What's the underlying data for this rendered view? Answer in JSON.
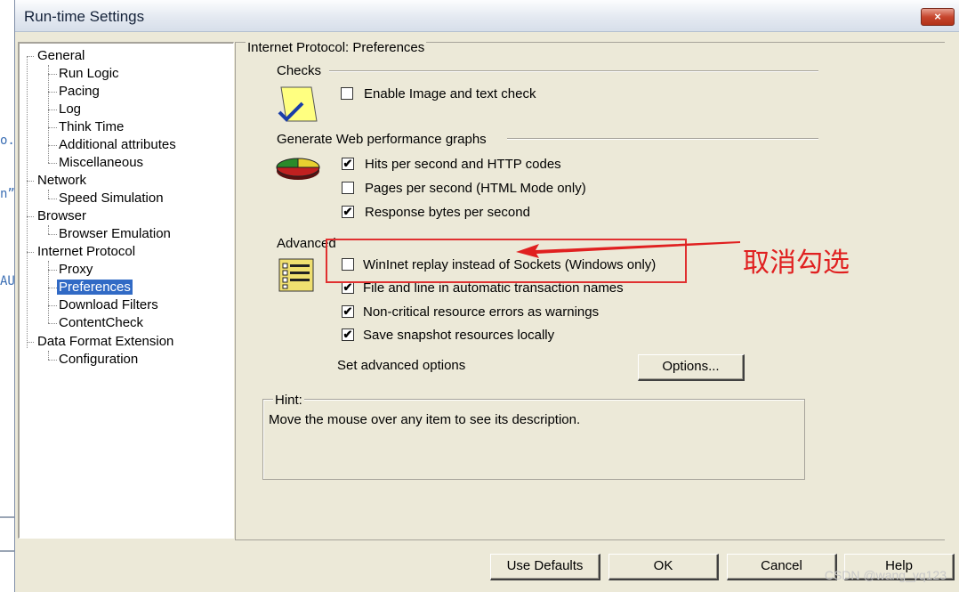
{
  "window": {
    "title": "Run-time Settings",
    "close_label": "×"
  },
  "background": {
    "chars": [
      "o.",
      "n”",
      "AU"
    ]
  },
  "tree": {
    "items": [
      {
        "label": "General",
        "level": 0
      },
      {
        "label": "Run Logic",
        "level": 1
      },
      {
        "label": "Pacing",
        "level": 1
      },
      {
        "label": "Log",
        "level": 1
      },
      {
        "label": "Think Time",
        "level": 1
      },
      {
        "label": "Additional attributes",
        "level": 1
      },
      {
        "label": "Miscellaneous",
        "level": 1
      },
      {
        "label": "Network",
        "level": 0
      },
      {
        "label": "Speed Simulation",
        "level": 1
      },
      {
        "label": "Browser",
        "level": 0
      },
      {
        "label": "Browser Emulation",
        "level": 1
      },
      {
        "label": "Internet Protocol",
        "level": 0
      },
      {
        "label": "Proxy",
        "level": 1
      },
      {
        "label": "Preferences",
        "level": 1,
        "selected": true
      },
      {
        "label": "Download Filters",
        "level": 1
      },
      {
        "label": "ContentCheck",
        "level": 1
      },
      {
        "label": "Data Format Extension",
        "level": 0
      },
      {
        "label": "Configuration",
        "level": 1
      }
    ]
  },
  "panel": {
    "title": "Internet Protocol: Preferences"
  },
  "checks": {
    "label": "Checks",
    "options": [
      {
        "label": "Enable Image and text check",
        "checked": false
      }
    ]
  },
  "graphs": {
    "label": "Generate Web performance graphs",
    "options": [
      {
        "label": "Hits per second and HTTP codes",
        "checked": true
      },
      {
        "label": "Pages per second (HTML Mode only)",
        "checked": false
      },
      {
        "label": "Response bytes per second",
        "checked": true
      }
    ]
  },
  "advanced": {
    "label": "Advanced",
    "options": [
      {
        "label": "WinInet replay instead of Sockets (Windows only)",
        "checked": false
      },
      {
        "label": "File and line in automatic transaction names",
        "checked": true
      },
      {
        "label": "Non-critical resource errors as warnings",
        "checked": true
      },
      {
        "label": "Save snapshot resources locally",
        "checked": true
      }
    ],
    "set_options_label": "Set advanced options",
    "options_button": "Options..."
  },
  "hint": {
    "label": "Hint:",
    "text": "Move the mouse over any item to see its description."
  },
  "buttons": {
    "use_defaults": "Use Defaults",
    "ok": "OK",
    "cancel": "Cancel",
    "help": "Help"
  },
  "annotation": {
    "text": "取消勾选",
    "color": "#e02020"
  },
  "watermark": "CSDN @wang_yq123",
  "colors": {
    "selection": "#316ac5",
    "dialog_bg": "#ece9d8",
    "annotation_red": "#e03030"
  }
}
